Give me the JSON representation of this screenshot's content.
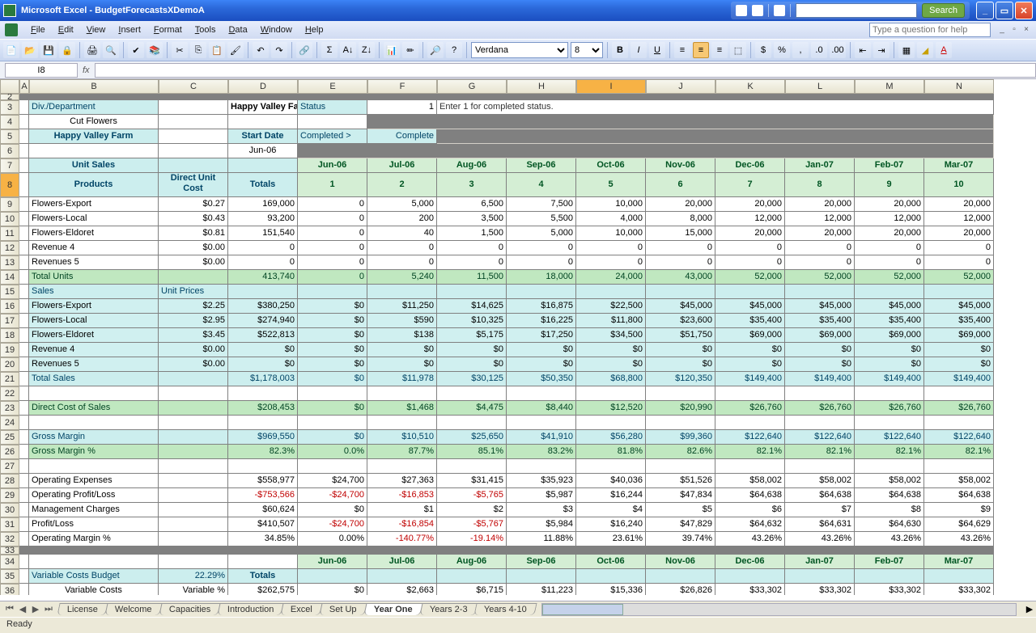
{
  "window": {
    "app": "Microsoft Excel",
    "doc": "BudgetForecastsXDemoA",
    "help_placeholder": "Type a question for help",
    "search_btn": "Search"
  },
  "menu": [
    "File",
    "Edit",
    "View",
    "Insert",
    "Format",
    "Tools",
    "Data",
    "Window",
    "Help"
  ],
  "font": {
    "name": "Verdana",
    "size": "8"
  },
  "namebox": "I8",
  "columns": [
    "A",
    "B",
    "C",
    "D",
    "E",
    "F",
    "G",
    "H",
    "I",
    "J",
    "K",
    "L",
    "M",
    "N"
  ],
  "col_widths": {
    "A": 12,
    "B": 160,
    "C": 86,
    "D": 86,
    "E": 86,
    "F": 86,
    "G": 86,
    "H": 86,
    "I": 86,
    "J": 86,
    "K": 86,
    "L": 86,
    "M": 86,
    "N": 86
  },
  "selected_col": "I",
  "selected_row": "8",
  "rows_visible": [
    "2",
    "3",
    "4",
    "5",
    "6",
    "7",
    "8",
    "9",
    "10",
    "11",
    "12",
    "13",
    "14",
    "15",
    "16",
    "17",
    "18",
    "19",
    "20",
    "21",
    "22",
    "23",
    "24",
    "25",
    "26",
    "27",
    "28",
    "29",
    "30",
    "31",
    "32",
    "33",
    "34",
    "35",
    "36"
  ],
  "header": {
    "valley": "Happy Valley Farm",
    "div": "Div./Department",
    "status": "Status",
    "status_val": "1",
    "status_hint": "Enter 1 for completed status.",
    "cut": "Cut Flowers",
    "farm": "Happy Valley Farm",
    "start": "Start Date",
    "completed": "Completed >",
    "complete": "Complete",
    "jun": "Jun-06"
  },
  "months": [
    "Jun-06",
    "Jul-06",
    "Aug-06",
    "Sep-06",
    "Oct-06",
    "Nov-06",
    "Dec-06",
    "Jan-07",
    "Feb-07",
    "Mar-07"
  ],
  "month_nums": [
    "1",
    "2",
    "3",
    "4",
    "5",
    "6",
    "7",
    "8",
    "9",
    "10"
  ],
  "labels": {
    "unit_sales": "Unit Sales",
    "products": "Products",
    "direct_unit_cost": "Direct Unit Cost",
    "totals": "Totals",
    "total_units": "Total Units",
    "sales": "Sales",
    "unit_prices": "Unit Prices",
    "total_sales": "Total Sales",
    "direct_cost": "Direct Cost of Sales",
    "gross_margin": "Gross Margin",
    "gross_margin_pct": "Gross Margin %",
    "op_exp": "Operating Expenses",
    "op_pl": "Operating Profit/Loss",
    "mgmt": "Management Charges",
    "pl": "Profit/Loss",
    "op_margin": "Operating Margin %",
    "var_budget": "Variable Costs Budget",
    "var_costs": "Variable Costs",
    "var_pct": "Variable %"
  },
  "data_rows": [
    {
      "n": "9",
      "label": "Flowers-Export",
      "c": "$0.27",
      "d": "169,000",
      "v": [
        "0",
        "5,000",
        "6,500",
        "7,500",
        "10,000",
        "20,000",
        "20,000",
        "20,000",
        "20,000",
        "20,000"
      ]
    },
    {
      "n": "10",
      "label": "Flowers-Local",
      "c": "$0.43",
      "d": "93,200",
      "v": [
        "0",
        "200",
        "3,500",
        "5,500",
        "4,000",
        "8,000",
        "12,000",
        "12,000",
        "12,000",
        "12,000"
      ]
    },
    {
      "n": "11",
      "label": "Flowers-Eldoret",
      "c": "$0.81",
      "d": "151,540",
      "v": [
        "0",
        "40",
        "1,500",
        "5,000",
        "10,000",
        "15,000",
        "20,000",
        "20,000",
        "20,000",
        "20,000"
      ]
    },
    {
      "n": "12",
      "label": "Revenue 4",
      "c": "$0.00",
      "d": "0",
      "v": [
        "0",
        "0",
        "0",
        "0",
        "0",
        "0",
        "0",
        "0",
        "0",
        "0"
      ]
    },
    {
      "n": "13",
      "label": "Revenues 5",
      "c": "$0.00",
      "d": "0",
      "v": [
        "0",
        "0",
        "0",
        "0",
        "0",
        "0",
        "0",
        "0",
        "0",
        "0"
      ]
    }
  ],
  "total_units": {
    "n": "14",
    "d": "413,740",
    "v": [
      "0",
      "5,240",
      "11,500",
      "18,000",
      "24,000",
      "43,000",
      "52,000",
      "52,000",
      "52,000",
      "52,000"
    ]
  },
  "sales_rows": [
    {
      "n": "16",
      "label": "Flowers-Export",
      "c": "$2.25",
      "d": "$380,250",
      "v": [
        "$0",
        "$11,250",
        "$14,625",
        "$16,875",
        "$22,500",
        "$45,000",
        "$45,000",
        "$45,000",
        "$45,000",
        "$45,000"
      ]
    },
    {
      "n": "17",
      "label": "Flowers-Local",
      "c": "$2.95",
      "d": "$274,940",
      "v": [
        "$0",
        "$590",
        "$10,325",
        "$16,225",
        "$11,800",
        "$23,600",
        "$35,400",
        "$35,400",
        "$35,400",
        "$35,400"
      ]
    },
    {
      "n": "18",
      "label": "Flowers-Eldoret",
      "c": "$3.45",
      "d": "$522,813",
      "v": [
        "$0",
        "$138",
        "$5,175",
        "$17,250",
        "$34,500",
        "$51,750",
        "$69,000",
        "$69,000",
        "$69,000",
        "$69,000"
      ]
    },
    {
      "n": "19",
      "label": "Revenue 4",
      "c": "$0.00",
      "d": "$0",
      "v": [
        "$0",
        "$0",
        "$0",
        "$0",
        "$0",
        "$0",
        "$0",
        "$0",
        "$0",
        "$0"
      ]
    },
    {
      "n": "20",
      "label": "Revenues 5",
      "c": "$0.00",
      "d": "$0",
      "v": [
        "$0",
        "$0",
        "$0",
        "$0",
        "$0",
        "$0",
        "$0",
        "$0",
        "$0",
        "$0"
      ]
    }
  ],
  "total_sales": {
    "n": "21",
    "d": "$1,178,003",
    "v": [
      "$0",
      "$11,978",
      "$30,125",
      "$50,350",
      "$68,800",
      "$120,350",
      "$149,400",
      "$149,400",
      "$149,400",
      "$149,400"
    ]
  },
  "direct_cost": {
    "n": "23",
    "d": "$208,453",
    "v": [
      "$0",
      "$1,468",
      "$4,475",
      "$8,440",
      "$12,520",
      "$20,990",
      "$26,760",
      "$26,760",
      "$26,760",
      "$26,760"
    ]
  },
  "gross_margin": {
    "n": "25",
    "d": "$969,550",
    "v": [
      "$0",
      "$10,510",
      "$25,650",
      "$41,910",
      "$56,280",
      "$99,360",
      "$122,640",
      "$122,640",
      "$122,640",
      "$122,640"
    ]
  },
  "gross_margin_pct": {
    "n": "26",
    "d": "82.3%",
    "v": [
      "0.0%",
      "87.7%",
      "85.1%",
      "83.2%",
      "81.8%",
      "82.6%",
      "82.1%",
      "82.1%",
      "82.1%",
      "82.1%"
    ]
  },
  "op_rows": [
    {
      "n": "28",
      "label": "Operating Expenses",
      "d": "$558,977",
      "v": [
        "$24,700",
        "$27,363",
        "$31,415",
        "$35,923",
        "$40,036",
        "$51,526",
        "$58,002",
        "$58,002",
        "$58,002",
        "$58,002"
      ]
    },
    {
      "n": "29",
      "label": "Operating Profit/Loss",
      "d": "-$753,566",
      "neg_d": true,
      "v": [
        "-$24,700",
        "-$16,853",
        "-$5,765",
        "$5,987",
        "$16,244",
        "$47,834",
        "$64,638",
        "$64,638",
        "$64,638",
        "$64,638"
      ],
      "neg": [
        true,
        true,
        true,
        false,
        false,
        false,
        false,
        false,
        false,
        false
      ]
    },
    {
      "n": "30",
      "label": "Management Charges",
      "d": "$60,624",
      "v": [
        "$0",
        "$1",
        "$2",
        "$3",
        "$4",
        "$5",
        "$6",
        "$7",
        "$8",
        "$9"
      ]
    },
    {
      "n": "31",
      "label": "Profit/Loss",
      "d": "$410,507",
      "v": [
        "-$24,700",
        "-$16,854",
        "-$5,767",
        "$5,984",
        "$16,240",
        "$47,829",
        "$64,632",
        "$64,631",
        "$64,630",
        "$64,629"
      ],
      "neg": [
        true,
        true,
        true,
        false,
        false,
        false,
        false,
        false,
        false,
        false
      ]
    },
    {
      "n": "32",
      "label": "Operating Margin %",
      "d": "34.85%",
      "v": [
        "0.00%",
        "-140.77%",
        "-19.14%",
        "11.88%",
        "23.61%",
        "39.74%",
        "43.26%",
        "43.26%",
        "43.26%",
        "43.26%"
      ],
      "neg": [
        false,
        true,
        true,
        false,
        false,
        false,
        false,
        false,
        false,
        false
      ]
    }
  ],
  "var_budget": {
    "n": "35",
    "c": "22.29%",
    "d": "Totals"
  },
  "var_costs": {
    "n": "36",
    "c": "Variable %",
    "d": "$262,575",
    "v": [
      "$0",
      "$2,663",
      "$6,715",
      "$11,223",
      "$15,336",
      "$26,826",
      "$33,302",
      "$33,302",
      "$33,302",
      "$33,302"
    ]
  },
  "sheets": [
    "License",
    "Welcome",
    "Capacities",
    "Introduction",
    "Excel",
    "Set Up",
    "Year One",
    "Years 2-3",
    "Years 4-10"
  ],
  "active_sheet": "Year One",
  "status": "Ready"
}
